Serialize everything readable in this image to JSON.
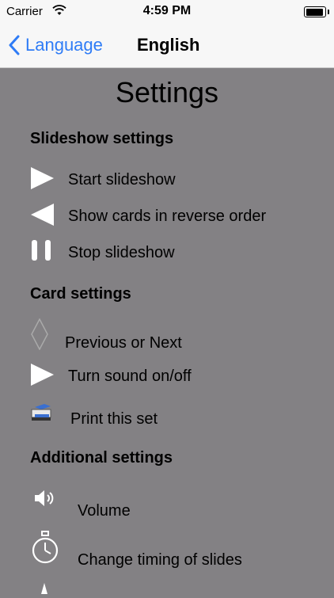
{
  "status": {
    "carrier": "Carrier",
    "time": "4:59 PM"
  },
  "nav": {
    "back_label": "Language",
    "title": "English"
  },
  "page": {
    "title": "Settings"
  },
  "sections": {
    "slideshow": "Slideshow settings",
    "card": "Card settings",
    "additional": "Additional settings"
  },
  "items": {
    "start_slideshow": "Start slideshow",
    "reverse_order": "Show cards in reverse order",
    "stop_slideshow": "Stop slideshow",
    "prev_next": "Previous or Next",
    "sound": "Turn sound on/off",
    "print": "Print this set",
    "volume": "Volume",
    "timing": "Change timing of slides"
  },
  "icons": {
    "start_slideshow": "play-icon",
    "reverse_order": "reverse-play-icon",
    "stop_slideshow": "pause-icon",
    "prev_next": "diamond-outline-icon",
    "sound": "play-icon",
    "print": "printer-icon",
    "volume": "speaker-icon",
    "timing": "stopwatch-icon"
  },
  "colors": {
    "background": "#838184",
    "accent": "#2f7cf6",
    "bar": "#f7f7f7"
  }
}
